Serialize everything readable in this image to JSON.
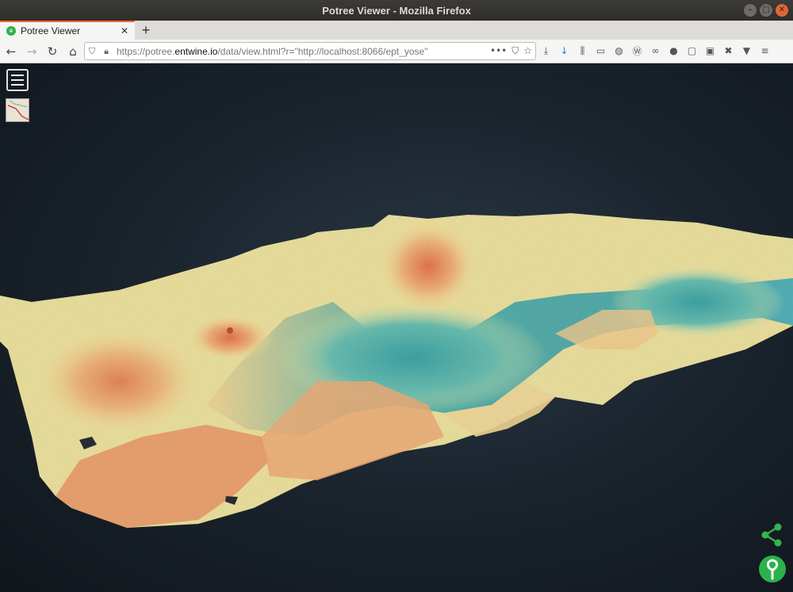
{
  "window": {
    "title": "Potree Viewer - Mozilla Firefox"
  },
  "tab": {
    "title": "Potree Viewer"
  },
  "address": {
    "url_prefix": "https://potree.",
    "url_host": "entwine.io",
    "url_rest": "/data/view.html?r=\"http://localhost:8066/ept_yose\""
  },
  "colors": {
    "accent": "#2bb24c",
    "terrain_low": "#2f9f9e",
    "terrain_mid": "#e8e28c",
    "terrain_high": "#e0673a"
  },
  "icons": [
    "back-icon",
    "forward-icon",
    "reload-icon",
    "home-icon",
    "shield-icon",
    "lock-icon",
    "menu-icon",
    "share-icon",
    "potree-logo-icon"
  ]
}
